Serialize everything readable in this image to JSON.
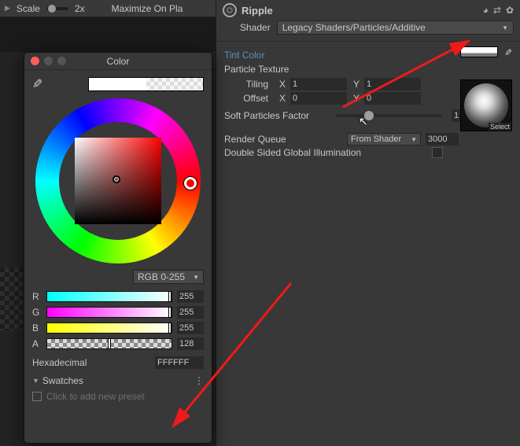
{
  "topbar": {
    "scale_label": "Scale",
    "scale_value": "2x",
    "maximize": "Maximize On Pla"
  },
  "material": {
    "name": "Ripple",
    "shader_label": "Shader",
    "shader_value": "Legacy Shaders/Particles/Additive",
    "tint_label": "Tint Color",
    "texture_label": "Particle Texture",
    "tiling_label": "Tiling",
    "offset_label": "Offset",
    "tiling_x": "1",
    "tiling_y": "1",
    "offset_x": "0",
    "offset_y": "0",
    "x_label": "X",
    "y_label": "Y",
    "soft_label": "Soft Particles Factor",
    "soft_value": "1",
    "queue_label": "Render Queue",
    "queue_mode": "From Shader",
    "queue_value": "3000",
    "dsgi_label": "Double Sided Global Illumination",
    "select_label": "Select"
  },
  "color_picker": {
    "title": "Color",
    "mode": "RGB 0-255",
    "r_label": "R",
    "g_label": "G",
    "b_label": "B",
    "a_label": "A",
    "r": "255",
    "g": "255",
    "b": "255",
    "a": "128",
    "hex_label": "Hexadecimal",
    "hex": "FFFFFF",
    "swatches_label": "Swatches",
    "preset_hint": "Click to add new preset"
  }
}
